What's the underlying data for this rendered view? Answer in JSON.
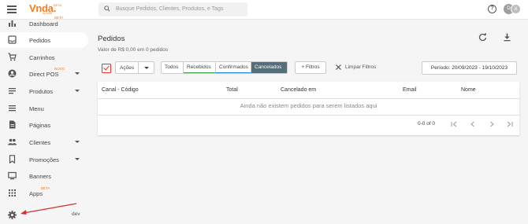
{
  "header": {
    "logo": "Vnda.",
    "logo_sub": "by MBR",
    "logo_badge": "BETA",
    "search_placeholder": "Busque Pedidos, Clientes, Produtos, e Tags",
    "help_glyph": "?",
    "avatar_initials": [
      "D",
      "X"
    ]
  },
  "sidebar": {
    "items": [
      {
        "label": "Dashboard",
        "icon": "bar-chart-icon"
      },
      {
        "label": "Pedidos",
        "icon": "inbox-icon",
        "active": true
      },
      {
        "label": "Carrinhos",
        "icon": "cart-icon"
      },
      {
        "label": "Direct POS",
        "icon": "person-icon",
        "badge": "NOVO",
        "expand": true
      },
      {
        "label": "Produtos",
        "icon": "list-icon",
        "expand": true
      },
      {
        "label": "Menu",
        "icon": "menu-icon"
      },
      {
        "label": "Páginas",
        "icon": "document-icon"
      },
      {
        "label": "Clientes",
        "icon": "people-icon",
        "expand": true
      },
      {
        "label": "Promoções",
        "icon": "bookmark-icon",
        "expand": true
      },
      {
        "label": "Banners",
        "icon": "monitor-icon"
      },
      {
        "label": "Apps",
        "icon": "grid-icon",
        "badge": "BETA"
      }
    ],
    "dashboard_badge": "BETA",
    "footer_user": "dev"
  },
  "main": {
    "title": "Pedidos",
    "subtitle": "Valor de R$ 0,00 em 0 pedidos",
    "actions_label": "Ações",
    "tabs": [
      {
        "label": "Todos"
      },
      {
        "label": "Recebidos"
      },
      {
        "label": "Confirmados"
      },
      {
        "label": "Cancelados",
        "selected": true
      }
    ],
    "filters_button": "+ Filtros",
    "clear_filters": "Limpar Filtros",
    "period": "Período: 20/09/2023 - 19/10/2023",
    "table": {
      "columns": [
        "Canal - Código",
        "Total",
        "Cancelado em",
        "Email",
        "Nome"
      ],
      "empty_message": "Ainda não existem pedidos para serem listados aqui",
      "pagination": "0-0 of 0"
    }
  },
  "colors": {
    "brand": "#f57c20",
    "checkbox": "#e53935",
    "tab_selected": "#546e7a",
    "tab_recebidos": "#43a047",
    "tab_confirmados": "#1e88e5",
    "annotation_arrow": "#d32f2f"
  }
}
